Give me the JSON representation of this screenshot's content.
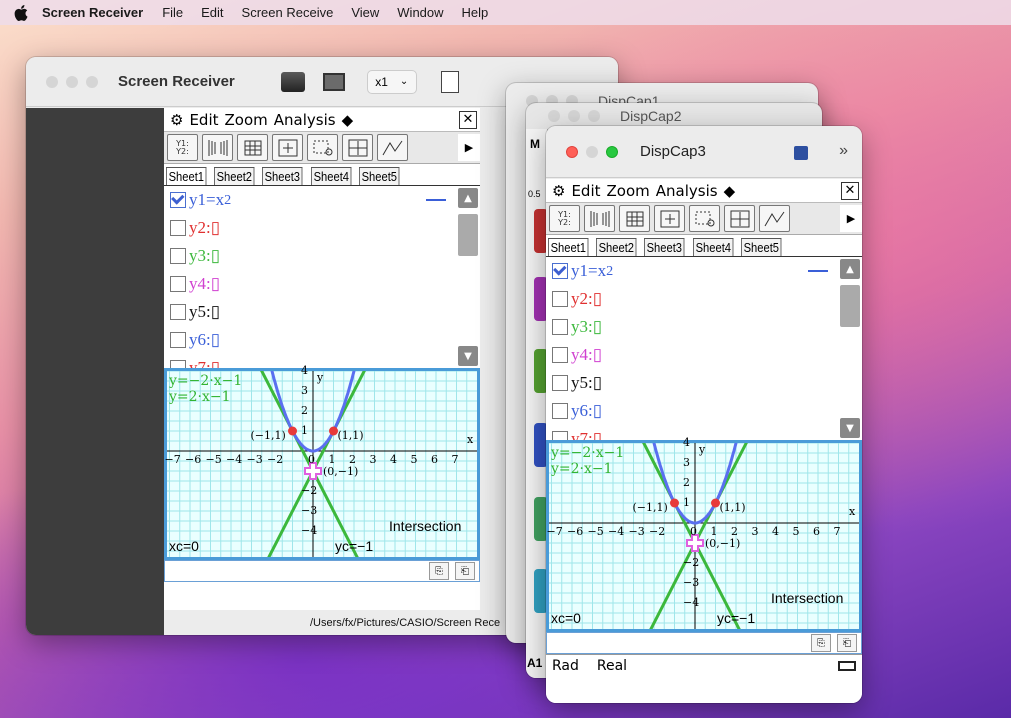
{
  "menubar": {
    "app": "Screen Receiver",
    "items": [
      "File",
      "Edit",
      "Screen Receive",
      "View",
      "Window",
      "Help"
    ]
  },
  "receiver": {
    "title": "Screen Receiver",
    "zoom": "x1",
    "path": "/Users/fx/Pictures/CASIO/Screen Rece",
    "status_rad": "Rad",
    "status_real": "Real"
  },
  "dispcap1": {
    "title": "DispCap1"
  },
  "dispcap2": {
    "title": "DispCap2"
  },
  "dispcap3": {
    "title": "DispCap3",
    "status_rad": "Rad",
    "status_real": "Real"
  },
  "calc": {
    "menu": [
      "Edit",
      "Zoom",
      "Analysis"
    ],
    "toolbar_first": "Y1:\nY2:",
    "tabs": [
      "Sheet1",
      "Sheet2",
      "Sheet3",
      "Sheet4",
      "Sheet5"
    ],
    "equations": [
      {
        "label": "y1=",
        "expr": "x",
        "sup": "2",
        "color": "#3a5fd8",
        "checked": true
      },
      {
        "label": "y2:",
        "expr": "▯",
        "sup": "",
        "color": "#e03030",
        "checked": false
      },
      {
        "label": "y3:",
        "expr": "▯",
        "sup": "",
        "color": "#3cb83c",
        "checked": false
      },
      {
        "label": "y4:",
        "expr": "▯",
        "sup": "",
        "color": "#d040d0",
        "checked": false
      },
      {
        "label": "y5:",
        "expr": "▯",
        "sup": "",
        "color": "#111111",
        "checked": false
      },
      {
        "label": "y6:",
        "expr": "▯",
        "sup": "",
        "color": "#3a5fd8",
        "checked": false
      },
      {
        "label": "y7:",
        "expr": "▯",
        "sup": "",
        "color": "#e03030",
        "checked": false
      }
    ],
    "graph": {
      "line1": "y=−2·x−1",
      "line2": "y=2·x−1",
      "xc": "xc=0",
      "yc": "yc=−1",
      "intersection": "Intersection",
      "pt_left": "(−1,1)",
      "pt_right": "(1,1)",
      "pt_center": "(0,−1)",
      "x_ticks": [
        "−7",
        "−6",
        "−5",
        "−4",
        "−3",
        "−2",
        "0",
        "1",
        "2",
        "3",
        "4",
        "5",
        "6",
        "7"
      ],
      "y_ticks": [
        "4",
        "3",
        "2",
        "1",
        "−2",
        "−3",
        "−4"
      ],
      "x_axis": "x",
      "y_axis": "y"
    },
    "colors": {
      "parabola": "#5a6ff0",
      "lines": "#3cb83c",
      "point": "#e83a3a",
      "cursor": "#e060e0",
      "grid": "#9fe6ea"
    }
  },
  "sidepanel": {
    "rows": [
      "M",
      "0.5"
    ],
    "cell": "A1"
  }
}
